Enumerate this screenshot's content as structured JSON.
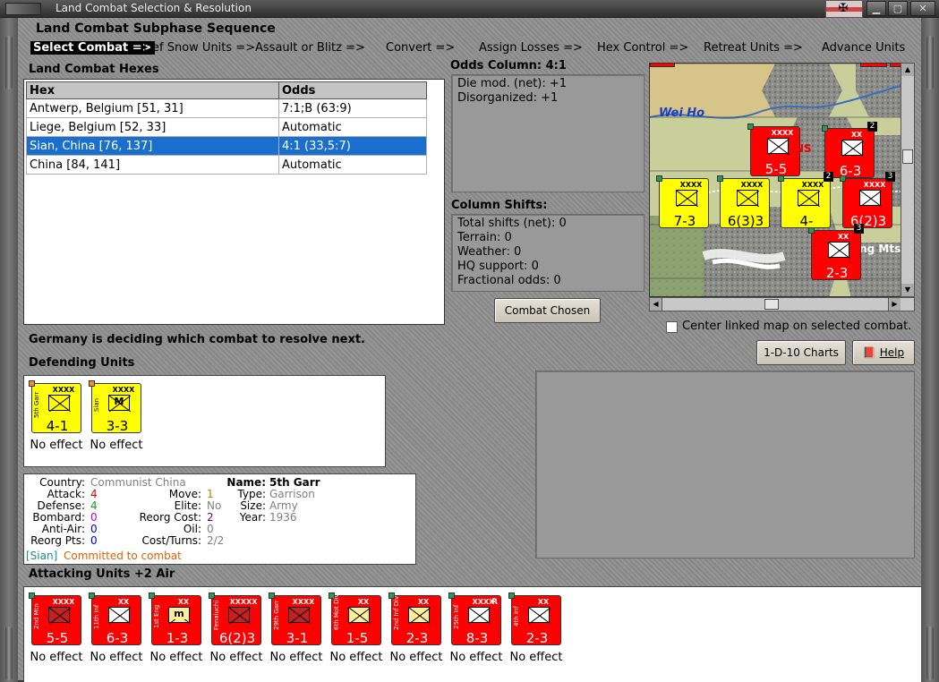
{
  "window": {
    "title": "Land Combat Selection & Resolution"
  },
  "subphase": {
    "title": "Land Combat Subphase Sequence",
    "steps": [
      "Select Combat =>",
      "Def Snow Units =>",
      "Assault or Blitz =>",
      "Convert =>",
      "Assign Losses =>",
      "Hex Control =>",
      "Retreat Units =>",
      "Advance Units"
    ]
  },
  "hexes": {
    "label": "Land Combat Hexes",
    "columns": [
      "Hex",
      "Odds"
    ],
    "rows": [
      {
        "hex": "Antwerp, Belgium [51, 31]",
        "odds": "7:1;B (63:9)"
      },
      {
        "hex": "Liege, Belgium [52, 33]",
        "odds": "Automatic"
      },
      {
        "hex": "Sian, China [76, 137]",
        "odds": "4:1 (33,5:7)"
      },
      {
        "hex": "China [84, 141]",
        "odds": "Automatic"
      }
    ],
    "selected_row": 2
  },
  "odds": {
    "title": "Odds Column: 4:1",
    "lines": [
      "Die mod. (net): +1",
      "Disorganized: +1"
    ]
  },
  "shifts": {
    "title": "Column Shifts:",
    "lines": [
      "Total shifts (net): 0",
      "Terrain: 0",
      "Weather: 0",
      "HQ support: 0",
      "Fractional odds: 0"
    ]
  },
  "buttons": {
    "combat_chosen": "Combat Chosen",
    "charts": "1-D-10 Charts",
    "help": "Help"
  },
  "map": {
    "labels": {
      "river": "Wei Ho",
      "mountains": "ing Mts",
      "city_fragment": "NS"
    },
    "counters": [
      {
        "strength": "5-5",
        "color": "red",
        "size": "XXXX"
      },
      {
        "strength": "6-3",
        "color": "red",
        "size": "XX",
        "badge": "2"
      },
      {
        "strength": "7-3",
        "color": "yellow",
        "size": "XXXX"
      },
      {
        "strength": "6(3)3",
        "color": "yellow",
        "size": "XXXX"
      },
      {
        "strength": "4-",
        "color": "yellow",
        "size": "XXXX",
        "badge": "2"
      },
      {
        "strength": "6(2)3",
        "color": "red",
        "size": "XXXX",
        "badge": "3"
      },
      {
        "strength": "2-3",
        "color": "red",
        "size": "XX",
        "badge": "3"
      }
    ],
    "center_linked_label": "Center linked map on selected combat.",
    "center_linked_checked": false
  },
  "status": {
    "message": "Germany is deciding which combat to resolve next."
  },
  "defending": {
    "label": "Defending Units",
    "units": [
      {
        "name": "5th Garr",
        "size": "XXXX",
        "strength": "4-1",
        "color": "yellow",
        "dot": "o",
        "symbol": "red",
        "result": "No effect"
      },
      {
        "name": "Sian",
        "size": "XXXX",
        "strength": "3-3",
        "color": "yellow",
        "dot": "o",
        "symbol": "red",
        "symbol_text": "M",
        "result": "No effect"
      }
    ]
  },
  "detail": {
    "country_label": "Country:",
    "country": "Communist China",
    "attack_label": "Attack:",
    "attack": "4",
    "defense_label": "Defense:",
    "defense": "4",
    "bombard_label": "Bombard:",
    "bombard": "0",
    "antiair_label": "Anti-Air:",
    "antiair": "0",
    "reorg_pts_label": "Reorg Pts:",
    "reorg_pts": "0",
    "move_label": "Move:",
    "move": "1",
    "elite_label": "Elite:",
    "elite": "No",
    "reorg_cost_label": "Reorg Cost:",
    "reorg_cost": "2",
    "oil_label": "Oil:",
    "oil": "0",
    "cost_turns_label": "Cost/Turns:",
    "cost_turns": "2/2",
    "name_label": "Name:",
    "name": "5th Garr",
    "type_label": "Type:",
    "type": "Garrison",
    "size_label": "Size:",
    "size": "Army",
    "year_label": "Year:",
    "year": "1936",
    "location": "[Sian]",
    "status": "Committed to combat"
  },
  "attacking": {
    "label": "Attacking Units +2 Air",
    "units": [
      {
        "name": "2nd Mtn",
        "size": "XXXX",
        "strength": "5-5",
        "symbol": "red",
        "result": "No effect"
      },
      {
        "name": "11th Inf",
        "size": "XX",
        "strength": "6-3",
        "symbol": "white",
        "result": "No effect"
      },
      {
        "name": "1st Eng",
        "size": "XX",
        "strength": "1-3",
        "symbol": "cream",
        "symbol_text": "m",
        "result": "No effect"
      },
      {
        "name": "Fenaiuchi",
        "size": "XXXXX",
        "strength": "6(2)3",
        "symbol": "red",
        "result": "No effect"
      },
      {
        "name": "29th Garr",
        "size": "XXXX",
        "strength": "3-1",
        "symbol": "red",
        "result": "No effect"
      },
      {
        "name": "6th Mot Div",
        "size": "XX",
        "strength": "1-5",
        "symbol": "cream",
        "result": "No effect"
      },
      {
        "name": "2nd Inf Div",
        "size": "XX",
        "strength": "2-3",
        "symbol": "cream",
        "result": "No effect"
      },
      {
        "name": "25th Inf",
        "size": "XXXX",
        "strength": "8-3",
        "symbol": "white",
        "r": "R",
        "result": "No effect"
      },
      {
        "name": "4th Inf",
        "size": "XX",
        "strength": "2-3",
        "symbol": "white",
        "result": "No effect"
      }
    ]
  },
  "colors": {
    "red": "#ff0000",
    "yellow": "#ffff00",
    "selection": "#1a6fce",
    "attack": "#e00000",
    "defense": "#1a9a1a",
    "bombard": "#c000c0",
    "antiair": "#0000c0",
    "location": "#1a8a8a",
    "status": "#e06000",
    "muted": "#808080"
  }
}
